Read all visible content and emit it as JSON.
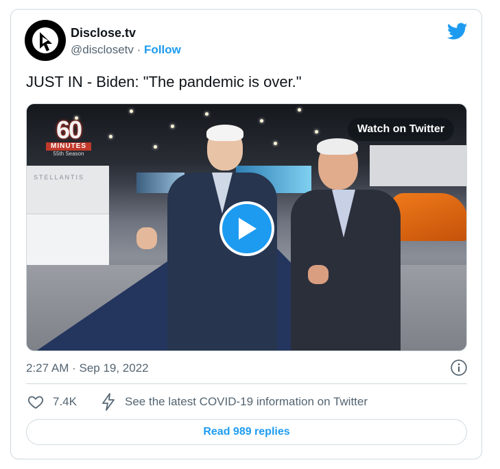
{
  "author": {
    "name": "Disclose.tv",
    "handle": "@disclosetv",
    "separator": "·",
    "follow_label": "Follow"
  },
  "tweet": {
    "text": "JUST IN - Biden: \"The pandemic is over.\"",
    "timestamp": "2:27 AM · Sep 19, 2022"
  },
  "media": {
    "watch_label": "Watch on Twitter",
    "overlay_logo": {
      "number": "60",
      "word": "MINUTES",
      "season": "55th Season"
    },
    "booth_sign": "STELLANTIS"
  },
  "actions": {
    "like_count": "7.4K",
    "covid_info_label": "See the latest COVID-19 information on Twitter",
    "replies_label": "Read 989 replies"
  },
  "colors": {
    "accent": "#1d9bf0",
    "text_primary": "#0f1419",
    "text_secondary": "#536471",
    "border": "#cfd9de"
  },
  "icons": [
    "disclose-avatar-icon",
    "twitter-bird-icon",
    "play-icon",
    "info-icon",
    "heart-icon",
    "bolt-icon"
  ]
}
